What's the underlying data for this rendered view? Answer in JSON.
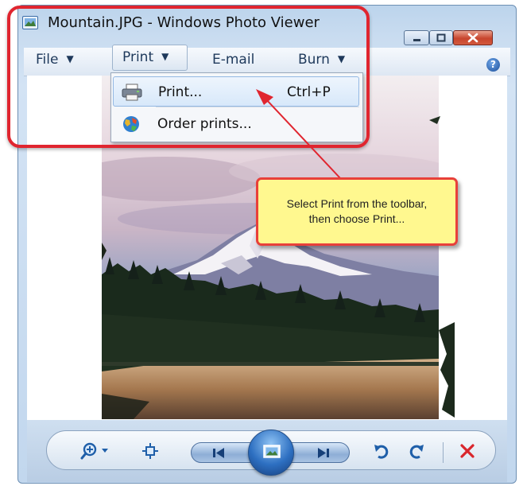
{
  "window": {
    "title": "Mountain.JPG - Windows Photo Viewer"
  },
  "toolbar": {
    "file_label": "File",
    "print_label": "Print",
    "email_label": "E-mail",
    "burn_label": "Burn",
    "help_glyph": "?"
  },
  "print_menu": {
    "items": [
      {
        "label": "Print...",
        "shortcut": "Ctrl+P",
        "icon": "printer-icon"
      },
      {
        "label": "Order prints...",
        "shortcut": "",
        "icon": "globe-icon"
      }
    ]
  },
  "callout": {
    "line1": "Select Print from the toolbar,",
    "line2": "then choose Print..."
  },
  "controls": {
    "icons": [
      "zoom-icon",
      "actual-size-icon",
      "previous-icon",
      "slideshow-icon",
      "next-icon",
      "rotate-counterclockwise-icon",
      "rotate-clockwise-icon",
      "delete-icon"
    ]
  },
  "colors": {
    "highlight": "#e0252f",
    "callout_fill": "#fff88f",
    "close_button": "#c8452d",
    "delete_red": "#d9262c"
  }
}
